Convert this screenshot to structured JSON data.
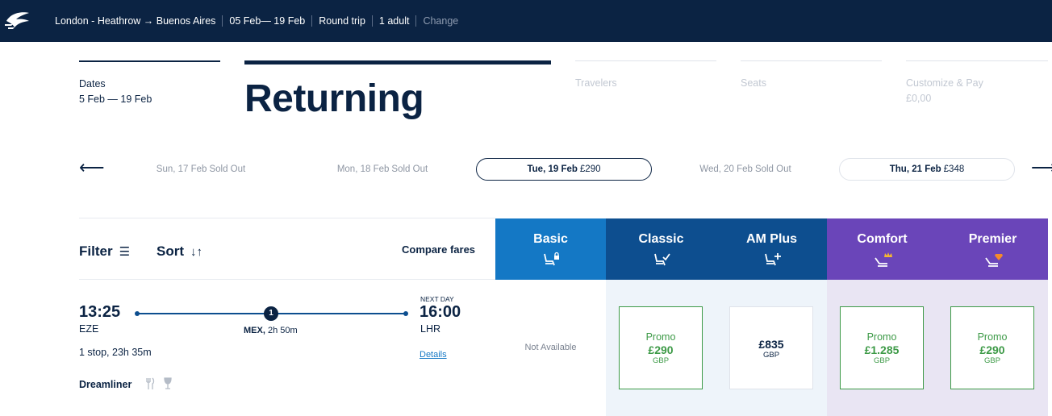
{
  "header": {
    "route": "London - Heathrow → Buenos Aires",
    "dates": "05 Feb— 19 Feb",
    "trip_type": "Round trip",
    "passengers": "1 adult",
    "change_link": "Change"
  },
  "stepper": {
    "dates_label": "Dates",
    "dates_value": "5 Feb — 19 Feb",
    "current_step": "Returning",
    "travelers_label": "Travelers",
    "seats_label": "Seats",
    "customize_label": "Customize & Pay",
    "customize_total": "£0,00"
  },
  "date_carousel": [
    {
      "day": "Sun, 17 Feb",
      "price": "Sold Out",
      "state": "sold-out"
    },
    {
      "day": "Mon, 18 Feb",
      "price": "Sold Out",
      "state": "sold-out"
    },
    {
      "day": "Tue, 19 Feb",
      "price": "£290",
      "state": "selected"
    },
    {
      "day": "Wed, 20 Feb",
      "price": "Sold Out",
      "state": "sold-out"
    },
    {
      "day": "Thu, 21 Feb",
      "price": "£348",
      "state": "available"
    }
  ],
  "controls": {
    "filter_label": "Filter",
    "sort_label": "Sort",
    "compare_label": "Compare fares"
  },
  "fare_classes": [
    {
      "name": "Basic",
      "icon": "seat-lock-icon"
    },
    {
      "name": "Classic",
      "icon": "seat-check-icon"
    },
    {
      "name": "AM Plus",
      "icon": "seat-plus-icon"
    },
    {
      "name": "Comfort",
      "icon": "seat-crown-icon"
    },
    {
      "name": "Premier",
      "icon": "seat-diamond-icon"
    }
  ],
  "flight": {
    "dep_time": "13:25",
    "dep_code": "EZE",
    "arr_note": "NEXT DAY",
    "arr_time": "16:00",
    "arr_code": "LHR",
    "stop_count": "1",
    "stop_airport": "MEX,",
    "stop_duration": "2h 50m",
    "stops_summary": "1 stop, 23h 35m",
    "details_link": "Details",
    "aircraft": "Dreamliner",
    "amenities": [
      "meal-icon",
      "drink-icon"
    ]
  },
  "fares": {
    "basic": "Not Available",
    "classic": {
      "label": "Promo",
      "price": "£290",
      "currency": "GBP"
    },
    "amplus": {
      "price": "£835",
      "currency": "GBP"
    },
    "comfort": {
      "label": "Promo",
      "price": "£1.285",
      "currency": "GBP"
    },
    "premier": {
      "label": "Promo",
      "price": "£290",
      "currency": "GBP"
    }
  },
  "colors": {
    "navy": "#0b2343",
    "basic_blue": "#1478c5",
    "classic_blue": "#0d4e8f",
    "purple": "#6a45b9",
    "promo_green": "#3d9a47"
  }
}
